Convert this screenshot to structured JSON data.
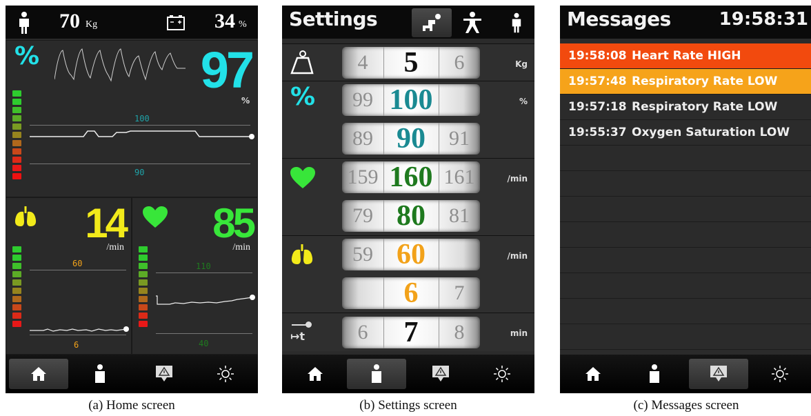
{
  "home": {
    "weight_value": "70",
    "weight_unit": "Kg",
    "battery_value": "34",
    "battery_unit": "%",
    "spo2": {
      "icon_label": "%",
      "value": "97",
      "unit": "%",
      "upper_threshold": "100",
      "lower_threshold": "90",
      "color": "#22e1e8"
    },
    "resp": {
      "value": "14",
      "unit": "/min",
      "upper_threshold": "60",
      "lower_threshold": "6",
      "color": "#f2ea1a"
    },
    "heart": {
      "value": "85",
      "unit": "/min",
      "upper_threshold": "110",
      "lower_threshold": "40",
      "color": "#38e63a"
    }
  },
  "settings": {
    "title": "Settings",
    "rows": [
      {
        "label": "weight",
        "left": "4",
        "center": "5",
        "right": "6",
        "unit": "Kg",
        "color": "#111111"
      },
      {
        "label": "spo2-high",
        "left": "99",
        "center": "100",
        "right": "",
        "unit": "%",
        "color": "#1a8a92"
      },
      {
        "label": "spo2-low",
        "left": "89",
        "center": "90",
        "right": "91",
        "unit": "",
        "color": "#1a8a92"
      },
      {
        "label": "heart-high",
        "left": "159",
        "center": "160",
        "right": "161",
        "unit": "/min",
        "color": "#1f7a1f"
      },
      {
        "label": "heart-low",
        "left": "79",
        "center": "80",
        "right": "81",
        "unit": "",
        "color": "#1f7a1f"
      },
      {
        "label": "resp-high",
        "left": "59",
        "center": "60",
        "right": "",
        "unit": "/min",
        "color": "#f2a21a"
      },
      {
        "label": "resp-low",
        "left": "",
        "center": "6",
        "right": "7",
        "unit": "",
        "color": "#f2a21a"
      },
      {
        "label": "time",
        "left": "6",
        "center": "7",
        "right": "8",
        "unit": "min",
        "color": "#111111"
      }
    ],
    "percent_icon": "%",
    "time_icon": "↦t"
  },
  "messages": {
    "title": "Messages",
    "clock": "19:58:31",
    "items": [
      {
        "time": "19:58:08",
        "text": "Heart Rate HIGH",
        "bg": "#f24a0e",
        "fg": "#ffffff"
      },
      {
        "time": "19:57:48",
        "text": "Respiratory Rate LOW",
        "bg": "#f6a31a",
        "fg": "#ffffff"
      },
      {
        "time": "19:57:18",
        "text": "Respiratory Rate LOW",
        "bg": "#2b2b2b",
        "fg": "#eeeeee"
      },
      {
        "time": "19:55:37",
        "text": "Oxygen Saturation LOW",
        "bg": "#2b2b2b",
        "fg": "#eeeeee"
      }
    ]
  },
  "captions": {
    "a": "(a) Home screen",
    "b": "(b) Settings screen",
    "c": "(c) Messages screen"
  }
}
